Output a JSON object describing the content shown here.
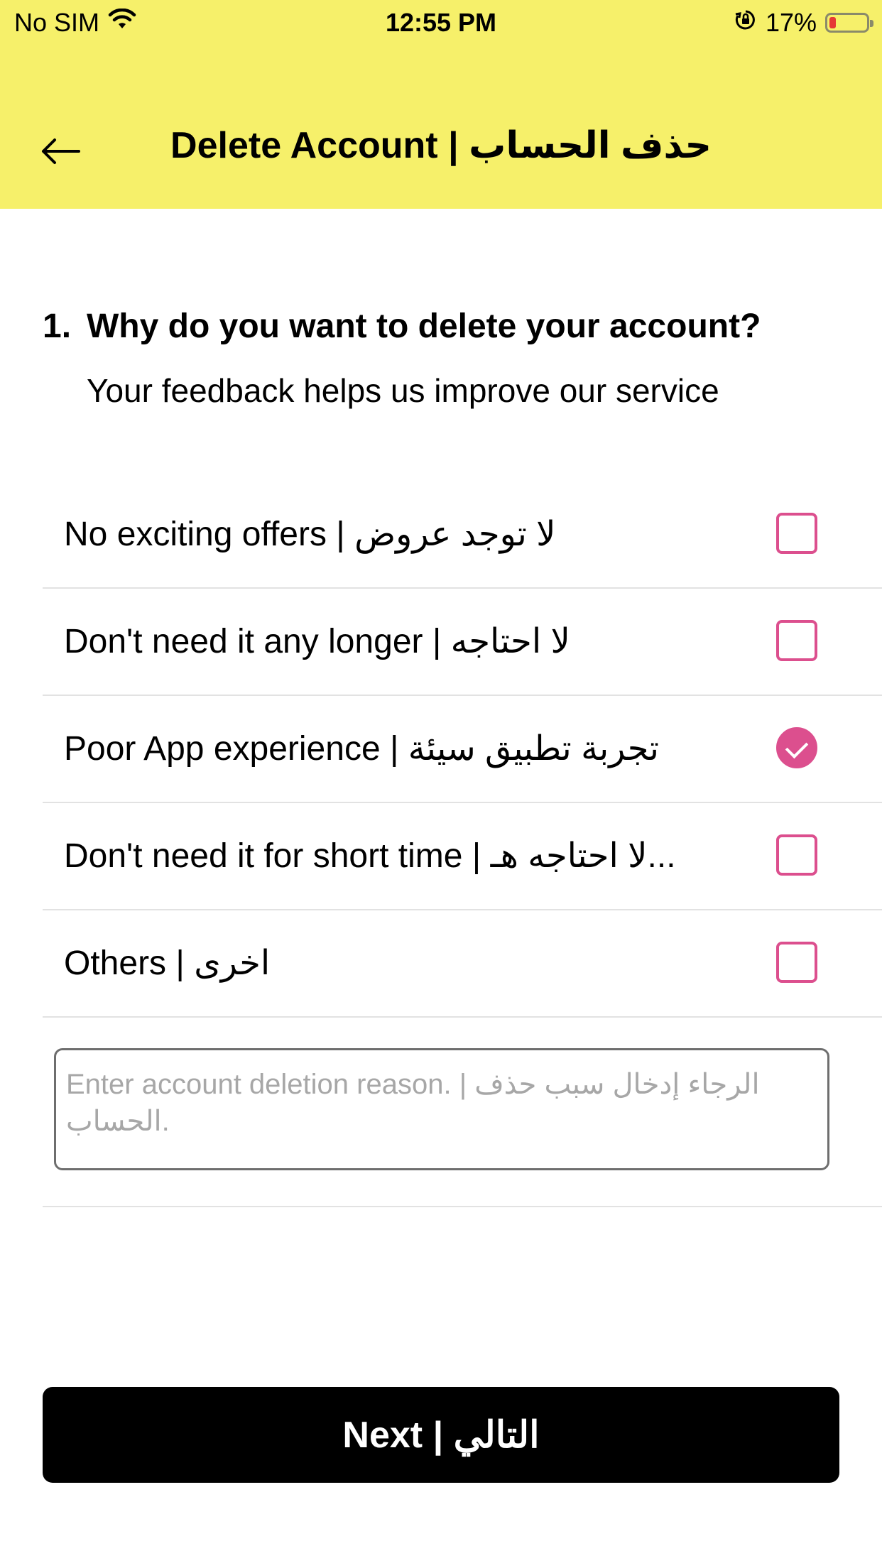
{
  "status_bar": {
    "carrier": "No SIM",
    "time": "12:55 PM",
    "battery_percent": "17%",
    "battery_level": 0.17,
    "icons": [
      "wifi-icon",
      "orientation-lock-icon",
      "battery-icon"
    ]
  },
  "header": {
    "title": "Delete Account | حذف الحساب",
    "back_icon": "back-arrow-icon",
    "background_color": "#f6f06a"
  },
  "question": {
    "number": "1.",
    "text": "Why do you want to delete your account?",
    "subtitle": "Your feedback helps us improve our service"
  },
  "options": [
    {
      "label": "No exciting offers | لا توجد عروض",
      "checked": false
    },
    {
      "label": "Don't need it any longer | لا احتاجه",
      "checked": false
    },
    {
      "label": "Poor App experience | تجربة تطبيق سيئة",
      "checked": true
    },
    {
      "label": "Don't need it for short time | لا احتاجه هـ...",
      "checked": false
    },
    {
      "label": "Others | اخرى",
      "checked": false
    }
  ],
  "reason_input": {
    "value": "",
    "placeholder": "Enter account deletion reason. | الرجاء إدخال سبب حذف الحساب."
  },
  "next_button": {
    "label": "Next | التالي"
  },
  "colors": {
    "accent": "#dc4f8e",
    "header": "#f6f06a",
    "button": "#000000"
  }
}
